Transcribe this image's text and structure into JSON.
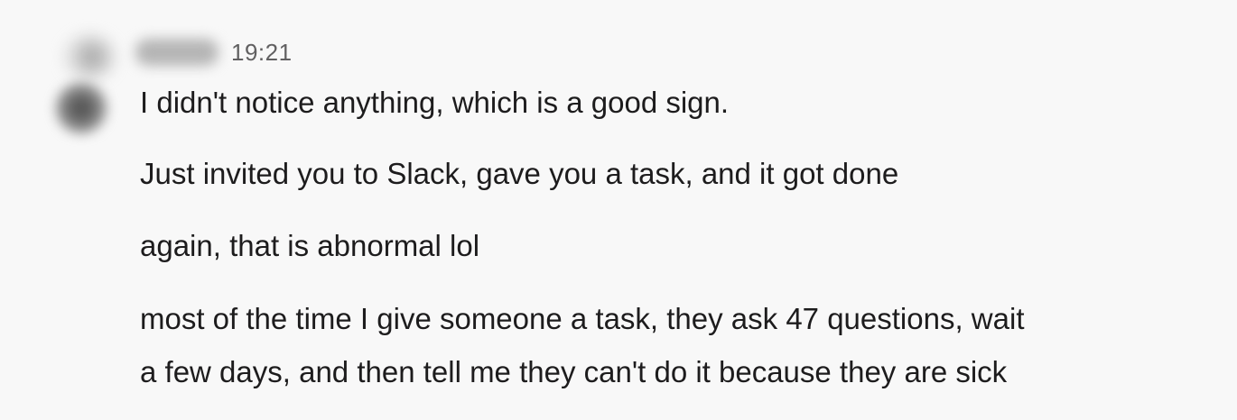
{
  "message": {
    "sender": {
      "avatar_icon": "user-avatar-blurred",
      "name": ""
    },
    "timestamp": "19:21",
    "lines": [
      "I didn't notice anything, which is a good sign.",
      "Just invited you to Slack, gave you a task, and it got done",
      "again, that is abnormal lol",
      "most of the time I give someone a task, they ask 47 questions, wait",
      "a few days, and then tell me they can't do it because they are sick"
    ]
  },
  "colors": {
    "background": "#f8f8f8",
    "text": "#1d1c1d",
    "timestamp": "#616061"
  }
}
